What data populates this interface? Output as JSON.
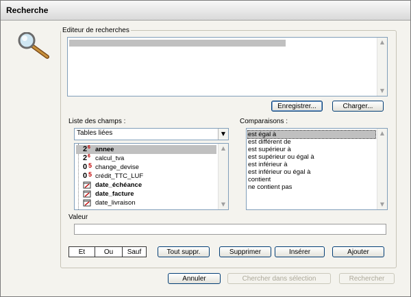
{
  "window": {
    "title": "Recherche"
  },
  "editor": {
    "label": "Editeur de recherches",
    "save_button": "Enregistrer...",
    "load_button": "Charger..."
  },
  "fields": {
    "label": "Liste des champs :",
    "table_select": "Tables liées",
    "items": [
      {
        "icon": "numeric-field-icon",
        "name": "annee",
        "bold": true,
        "selected": true
      },
      {
        "icon": "numeric-field-icon",
        "name": "calcul_tva",
        "bold": false,
        "selected": false
      },
      {
        "icon": "currency-field-icon",
        "name": "change_devise",
        "bold": false,
        "selected": false
      },
      {
        "icon": "currency-field-icon",
        "name": "crédit_TTC_LUF",
        "bold": false,
        "selected": false
      },
      {
        "icon": "date-field-icon",
        "name": "date_échéance",
        "bold": true,
        "selected": false
      },
      {
        "icon": "date-field-icon",
        "name": "date_facture",
        "bold": true,
        "selected": false
      },
      {
        "icon": "date-field-icon",
        "name": "date_livraison",
        "bold": false,
        "selected": false
      }
    ]
  },
  "comparisons": {
    "label": "Comparaisons :",
    "items": [
      "est égal à",
      "est différent de",
      "est supérieur à",
      "est supérieur ou égal à",
      "est inférieur à",
      "est inférieur ou égal à",
      "contient",
      "ne contient pas"
    ]
  },
  "value": {
    "label": "Valeur",
    "current": ""
  },
  "operators": {
    "and": "Et",
    "or": "Ou",
    "except": "Sauf"
  },
  "actions": {
    "clear_all": "Tout suppr.",
    "delete": "Supprimer",
    "insert": "Insérer",
    "add": "Ajouter"
  },
  "footer": {
    "cancel": "Annuler",
    "search_in_selection": "Chercher dans sélection",
    "search": "Rechercher"
  },
  "colors": {
    "selection": "#c0c0c0",
    "icon_red": "#c00000",
    "border_blue": "#7f9db9"
  }
}
